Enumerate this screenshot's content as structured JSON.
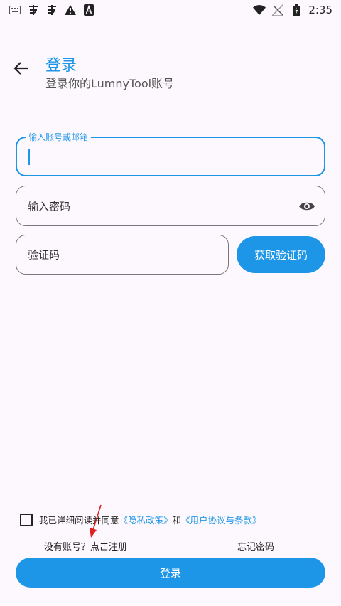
{
  "status_bar": {
    "time": "2:35",
    "left_icons": [
      "keyboard-icon",
      "bug-icon",
      "bug-icon",
      "warning-icon",
      "font-a-icon"
    ],
    "right_icons": [
      "wifi-icon",
      "no-signal-icon",
      "battery-charging-icon"
    ]
  },
  "header": {
    "back_icon": "arrow-left-icon",
    "title": "登录",
    "subtitle": "登录你的LumnyTool账号"
  },
  "form": {
    "account_label": "输入账号或邮箱",
    "password_placeholder": "输入密码",
    "password_toggle_icon": "eye-icon",
    "code_placeholder": "验证码",
    "get_code_button": "获取验证码"
  },
  "agreement": {
    "checked": false,
    "text": "我已详细阅读并同意",
    "privacy_link": "《隐私政策》",
    "joiner": "和",
    "terms_link": "《用户协议与条款》"
  },
  "links": {
    "register": "没有账号？点击注册",
    "forgot_password": "忘记密码"
  },
  "login_button": "登录",
  "colors": {
    "accent": "#1e96e8",
    "background": "#fdf8fd",
    "annotation": "#e02020"
  }
}
